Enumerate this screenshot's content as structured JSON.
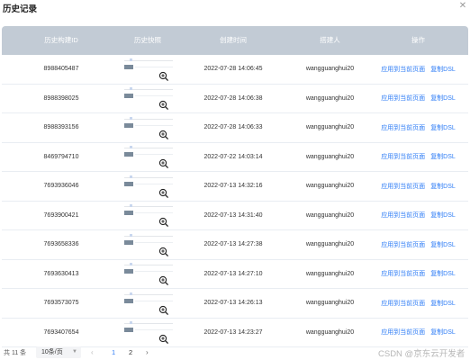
{
  "header": {
    "title": "历史记录",
    "close_icon": "close-icon"
  },
  "table": {
    "columns": [
      "历史构建ID",
      "历史快照",
      "创建时间",
      "搭建人",
      "操作"
    ],
    "rows": [
      {
        "id": "8988405487",
        "created": "2022-07-28 14:06:45",
        "builder": "wangguanghui20",
        "apply": "应用到当前页面",
        "copy": "复制DSL"
      },
      {
        "id": "8988398025",
        "created": "2022-07-28 14:06:38",
        "builder": "wangguanghui20",
        "apply": "应用到当前页面",
        "copy": "复制DSL"
      },
      {
        "id": "8988393156",
        "created": "2022-07-28 14:06:33",
        "builder": "wangguanghui20",
        "apply": "应用到当前页面",
        "copy": "复制DSL"
      },
      {
        "id": "8469794710",
        "created": "2022-07-22 14:03:14",
        "builder": "wangguanghui20",
        "apply": "应用到当前页面",
        "copy": "复制DSL"
      },
      {
        "id": "7693936046",
        "created": "2022-07-13 14:32:16",
        "builder": "wangguanghui20",
        "apply": "应用到当前页面",
        "copy": "复制DSL"
      },
      {
        "id": "7693900421",
        "created": "2022-07-13 14:31:40",
        "builder": "wangguanghui20",
        "apply": "应用到当前页面",
        "copy": "复制DSL"
      },
      {
        "id": "7693658336",
        "created": "2022-07-13 14:27:38",
        "builder": "wangguanghui20",
        "apply": "应用到当前页面",
        "copy": "复制DSL"
      },
      {
        "id": "7693630413",
        "created": "2022-07-13 14:27:10",
        "builder": "wangguanghui20",
        "apply": "应用到当前页面",
        "copy": "复制DSL"
      },
      {
        "id": "7693573075",
        "created": "2022-07-13 14:26:13",
        "builder": "wangguanghui20",
        "apply": "应用到当前页面",
        "copy": "复制DSL"
      },
      {
        "id": "7693407654",
        "created": "2022-07-13 14:23:27",
        "builder": "wangguanghui20",
        "apply": "应用到当前页面",
        "copy": "复制DSL"
      }
    ]
  },
  "pagination": {
    "total": "共 11 条",
    "page_size": "10条/页",
    "pages": [
      "1",
      "2"
    ],
    "current_page": "1",
    "prev_icon": "chevron-left-icon",
    "next_icon": "chevron-right-icon"
  },
  "watermark": "CSDN @京东云开发者",
  "colors": {
    "header_bg": "#c2cbd5",
    "link": "#2f7df6",
    "row_border": "#e9edf2"
  }
}
